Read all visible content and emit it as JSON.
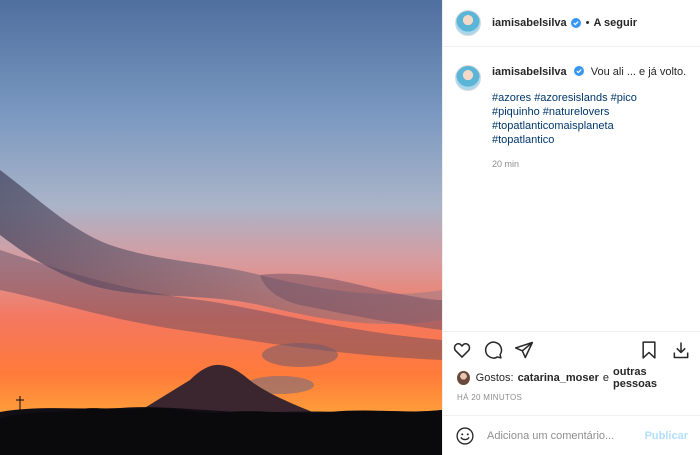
{
  "post": {
    "username": "iamisabelsilva",
    "follow_separator": "•",
    "follow_label": "A seguir",
    "caption": {
      "text": "Vou ali ... e já volto.",
      "hashtags": [
        "#azores #azoresislands #pico",
        "#piquinho #naturelovers",
        "#topatlanticomaisplaneta",
        "#topatlantico"
      ],
      "age": "20 min"
    },
    "likes": {
      "prefix": "Gostos:",
      "user": "catarina_moser",
      "connector": "e",
      "others": "outras pessoas"
    },
    "date": "HÁ 20 MINUTOS",
    "comment": {
      "placeholder": "Adiciona um comentário...",
      "publish": "Publicar"
    }
  },
  "icons": [
    "heart-icon",
    "comment-icon",
    "share-icon",
    "bookmark-icon",
    "download-icon",
    "emoji-icon",
    "verified-icon"
  ],
  "colors": {
    "link": "#00376b",
    "muted": "#8e8e8e",
    "verified": "#3897f0",
    "publish_disabled": "#b2dffc"
  }
}
